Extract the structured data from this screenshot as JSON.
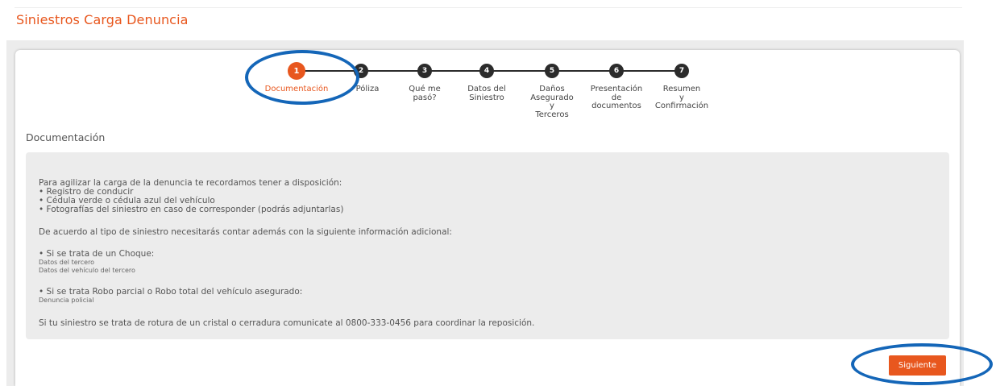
{
  "header": {
    "title": "Siniestros Carga Denuncia"
  },
  "stepper": {
    "steps": [
      {
        "number": "1",
        "label": "Documentación",
        "active": true
      },
      {
        "number": "2",
        "label": "Póliza",
        "active": false
      },
      {
        "number": "3",
        "label": "Qué me\npasó?",
        "active": false
      },
      {
        "number": "4",
        "label": "Datos del\nSiniestro",
        "active": false
      },
      {
        "number": "5",
        "label": "Daños\nAsegurado\ny\nTerceros",
        "active": false
      },
      {
        "number": "6",
        "label": "Presentación\nde\ndocumentos",
        "active": false
      },
      {
        "number": "7",
        "label": "Resumen\ny\nConfirmación",
        "active": false
      }
    ]
  },
  "section": {
    "heading": "Documentación"
  },
  "info": {
    "intro": "Para agilizar la carga de la denuncia te recordamos tener a disposición:",
    "item_1": "• Registro de conducir",
    "item_2": "• Cédula verde o cédula azul del vehículo",
    "item_3": "• Fotografías del siniestro en caso de corresponder (podrás adjuntarlas)",
    "additional": "De acuerdo al tipo de siniestro necesitarás contar además con la siguiente información adicional:",
    "choque_title": "• Si se trata de un Choque:",
    "choque_1": "Datos del tercero",
    "choque_2": "Datos del vehículo del tercero",
    "robo_title": "• Si se trata Robo parcial o Robo total del vehículo asegurado:",
    "robo_1": "Denuncia policial",
    "cristal": "Si tu siniestro se trata de rotura de un cristal o cerradura comunicate al 0800-333-0456 para coordinar la reposición."
  },
  "actions": {
    "next_label": "Siguiente"
  },
  "colors": {
    "accent": "#e8571e",
    "annotation": "#1466b8",
    "step_inactive": "#2b2b2b"
  }
}
